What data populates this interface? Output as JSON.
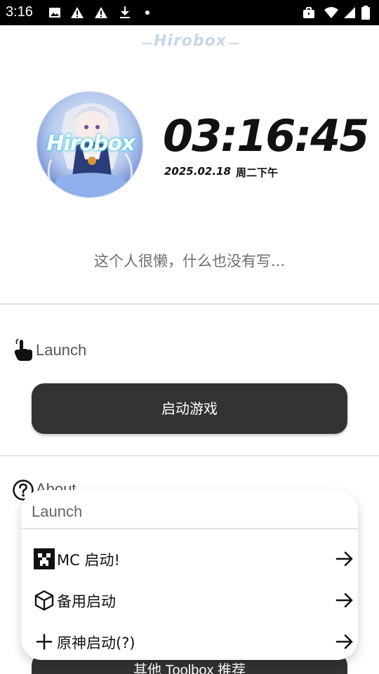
{
  "status_bar": {
    "time": "3:16",
    "left_icons": [
      "image-icon",
      "warning-icon",
      "warning-icon",
      "download-icon",
      "dot-icon"
    ],
    "right_icons": [
      "briefcase-icon",
      "wifi-icon",
      "signal-icon",
      "battery-icon"
    ]
  },
  "header": {
    "logo_text": "Hirobox"
  },
  "profile": {
    "avatar_text": "Hirobox",
    "clock_time": "03:16:45",
    "clock_date": "2025.02.18",
    "clock_weekday": "周二下午",
    "bio": "这个人很懒，什么也没有写..."
  },
  "launch_section": {
    "label": "Launch",
    "icon": "pointer-hand-icon",
    "start_button": "启动游戏"
  },
  "about_section": {
    "label": "About",
    "icon": "help-circle-icon",
    "button": "其他 Toolbox 推荐"
  },
  "popup": {
    "title": "Launch",
    "items": [
      {
        "label": "MC 启动!",
        "icon": "creeper-icon",
        "arrow": "arrow-right-icon"
      },
      {
        "label": "备用启动",
        "icon": "cube-icon",
        "arrow": "arrow-right-icon"
      },
      {
        "label": "原神启动(?)",
        "icon": "plus-icon",
        "arrow": "arrow-right-icon"
      }
    ]
  },
  "colors": {
    "button_bg": "#333333",
    "logo": "#c7d7ea",
    "bio_text": "#6c6c6c",
    "divider": "#e3e3e3",
    "avatar_glow": "#2fd0e6"
  }
}
